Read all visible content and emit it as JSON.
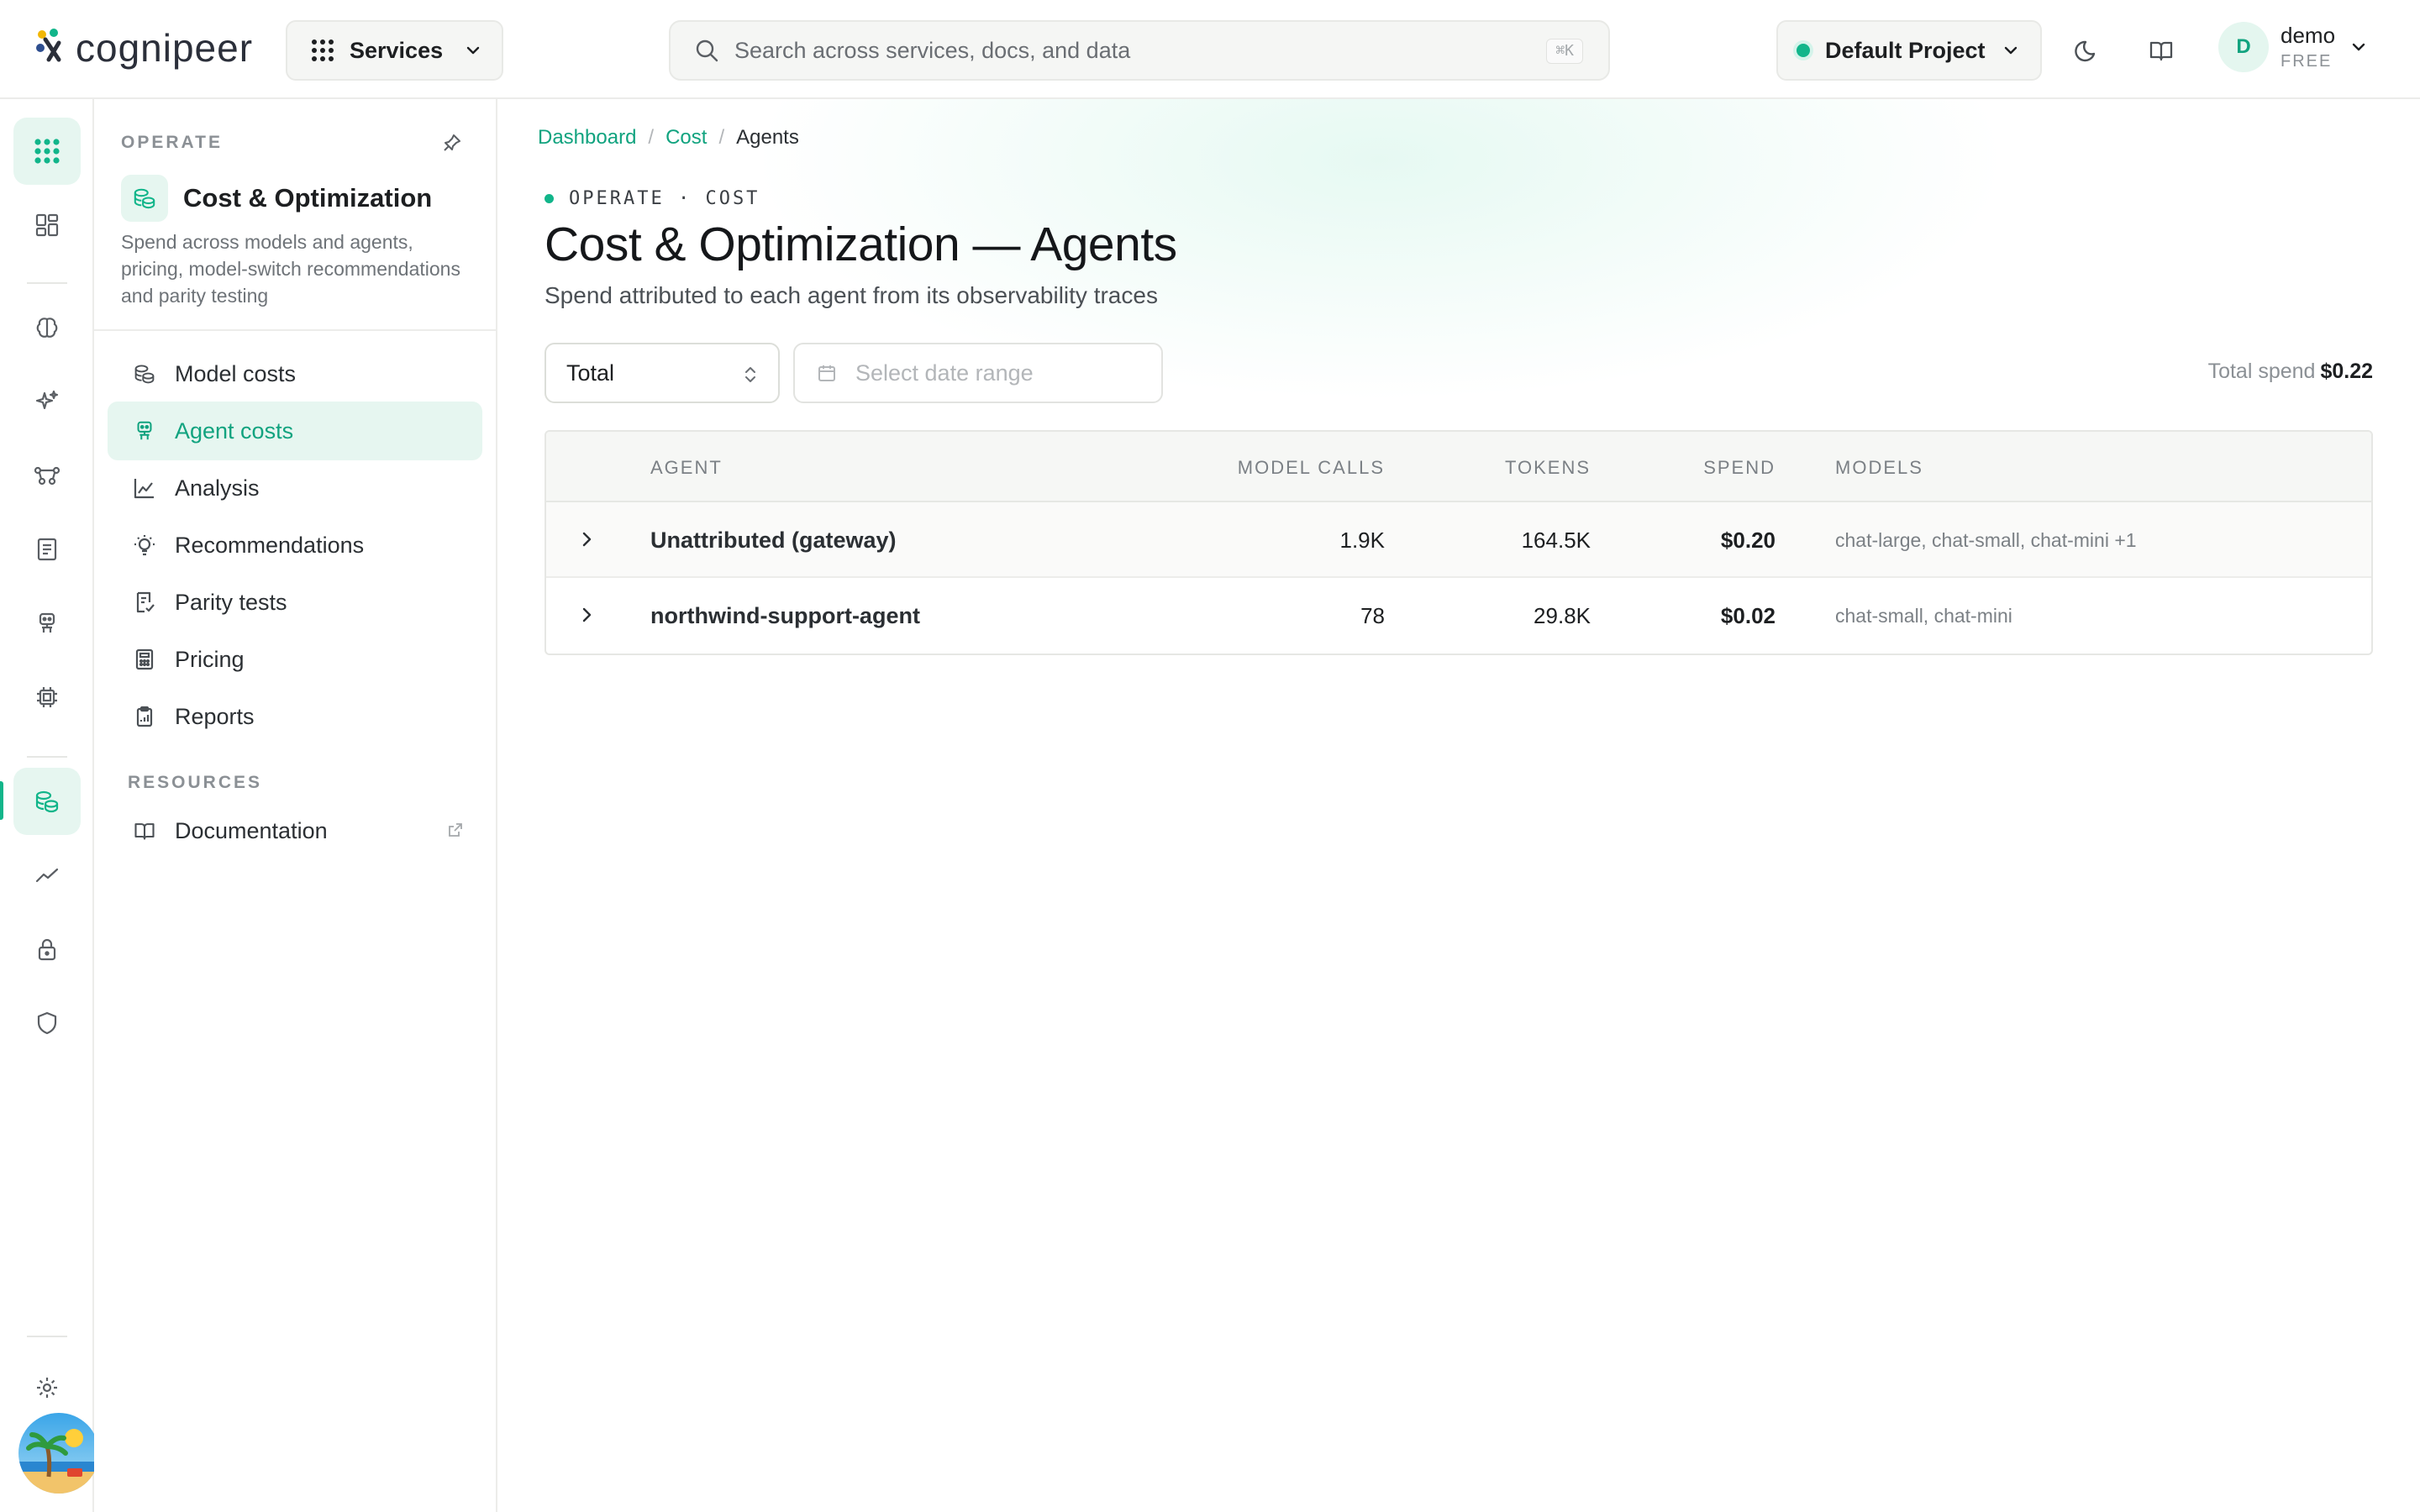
{
  "header": {
    "logo_text": "cognipeer",
    "services_label": "Services",
    "search_placeholder": "Search across services, docs, and data",
    "search_shortcut": "⌘K",
    "project_label": "Default Project",
    "user": {
      "initial": "D",
      "name": "demo",
      "plan": "FREE"
    }
  },
  "rail": {
    "items": [
      "grid-icon",
      "dashboard-icon",
      "brain-icon",
      "sparkles-icon",
      "flow-icon",
      "document-icon",
      "agent-icon",
      "chip-icon",
      "coins-icon",
      "chart-line-icon",
      "lock-icon",
      "shield-icon",
      "settings-icon"
    ],
    "active": "coins-icon"
  },
  "subnav": {
    "section_label": "OPERATE",
    "module_title": "Cost & Optimization",
    "module_desc": "Spend across models and agents, pricing, model-switch recommendations and parity testing",
    "items": [
      {
        "label": "Model costs",
        "icon": "coins-icon"
      },
      {
        "label": "Agent costs",
        "icon": "agent-icon",
        "active": true
      },
      {
        "label": "Analysis",
        "icon": "chart-area-icon"
      },
      {
        "label": "Recommendations",
        "icon": "lightbulb-icon"
      },
      {
        "label": "Parity tests",
        "icon": "checklist-icon"
      },
      {
        "label": "Pricing",
        "icon": "calculator-icon"
      },
      {
        "label": "Reports",
        "icon": "clipboard-icon"
      }
    ],
    "resources_label": "RESOURCES",
    "resources": [
      {
        "label": "Documentation",
        "icon": "book-icon"
      }
    ]
  },
  "main": {
    "breadcrumb": [
      "Dashboard",
      "Cost",
      "Agents"
    ],
    "eyebrow": "OPERATE · COST",
    "title": "Cost & Optimization — Agents",
    "subtitle": "Spend attributed to each agent from its observability traces",
    "period_select": "Total",
    "date_placeholder": "Select date range",
    "total_spend_label": "Total spend",
    "total_spend_value": "$0.22",
    "table": {
      "columns": [
        "AGENT",
        "MODEL CALLS",
        "TOKENS",
        "SPEND",
        "MODELS"
      ],
      "rows": [
        {
          "agent": "Unattributed (gateway)",
          "calls": "1.9K",
          "tokens": "164.5K",
          "spend": "$0.20",
          "models": "chat-large, chat-small, chat-mini +1"
        },
        {
          "agent": "northwind-support-agent",
          "calls": "78",
          "tokens": "29.8K",
          "spend": "$0.02",
          "models": "chat-small, chat-mini"
        }
      ]
    }
  },
  "colors": {
    "accent": "#11b58a",
    "accent_text": "#11a37f",
    "active_bg": "#e6f6f0"
  }
}
